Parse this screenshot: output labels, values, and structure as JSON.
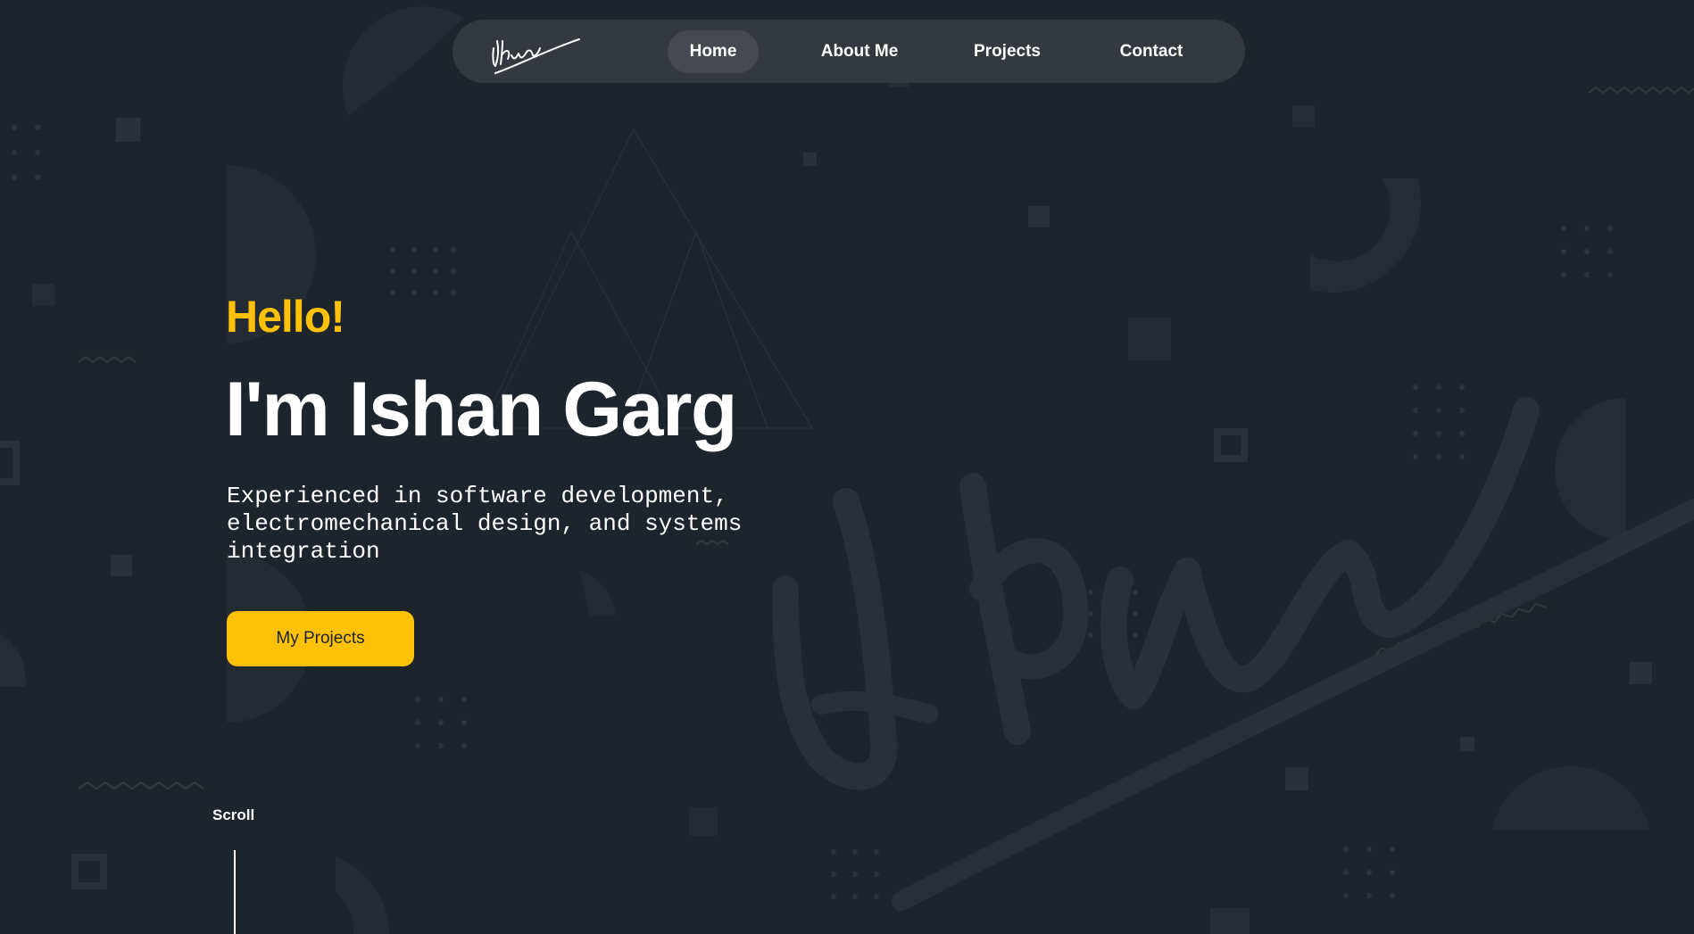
{
  "nav": {
    "logo_alt": "Ishan signature logo",
    "items": [
      {
        "label": "Home",
        "active": true
      },
      {
        "label": "About Me",
        "active": false
      },
      {
        "label": "Projects",
        "active": false
      },
      {
        "label": "Contact",
        "active": false
      }
    ]
  },
  "hero": {
    "greeting": "Hello!",
    "name": "I'm Ishan Garg",
    "tagline": "Experienced in software development, electromechanical design, and systems integration",
    "cta_label": "My Projects"
  },
  "scroll": {
    "label": "Scroll"
  },
  "colors": {
    "background": "#1e242c",
    "navbar": "#34383f",
    "nav_active": "#464a50",
    "accent": "#fdc107",
    "text": "#ffffff",
    "decor": "#2a3038"
  },
  "icons": {
    "logo": "signature-logo",
    "background_watermark": "signature-watermark"
  }
}
